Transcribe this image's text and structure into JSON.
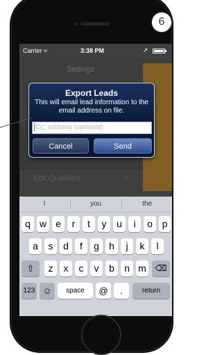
{
  "badge": "6",
  "status": {
    "carrier": "Carrier",
    "time": "3:38 PM"
  },
  "nav": {
    "title": "Settings"
  },
  "background": {
    "edit_qualifiers": "Edit Qualifiers"
  },
  "dialog": {
    "title": "Export Leads",
    "message": "This will email lead information to the email address on file.",
    "input_placeholder": "Cc: address (optional)",
    "cancel": "Cancel",
    "send": "Send"
  },
  "keyboard": {
    "suggestions": [
      "I",
      "you",
      "the"
    ],
    "row1": [
      "q",
      "w",
      "e",
      "r",
      "t",
      "y",
      "u",
      "i",
      "o",
      "p"
    ],
    "row2": [
      "a",
      "s",
      "d",
      "f",
      "g",
      "h",
      "j",
      "k",
      "l"
    ],
    "row3": [
      "z",
      "x",
      "c",
      "v",
      "b",
      "n",
      "m"
    ],
    "numbers": "123",
    "space": "space",
    "at": "@",
    "dot": ".",
    "return": "return"
  }
}
